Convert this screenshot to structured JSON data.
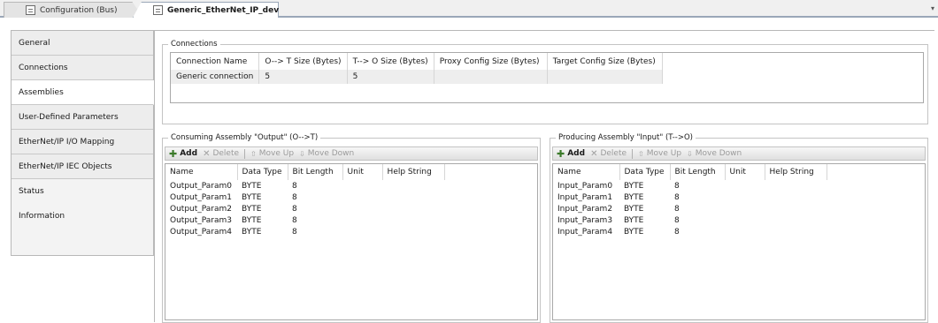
{
  "tabs": [
    {
      "label": "Configuration (Bus)",
      "icon": "config-icon"
    },
    {
      "label": "Generic_EtherNet_IP_device",
      "icon": "device-icon",
      "close": "x"
    }
  ],
  "nav": {
    "items": [
      {
        "label": "General"
      },
      {
        "label": "Connections"
      },
      {
        "label": "Assemblies"
      },
      {
        "label": "User-Defined Parameters"
      },
      {
        "label": "EtherNet/IP I/O Mapping"
      },
      {
        "label": "EtherNet/IP IEC Objects"
      },
      {
        "label": "Status"
      },
      {
        "label": "Information"
      }
    ],
    "selected": "Assemblies"
  },
  "connections": {
    "title": "Connections",
    "columns": [
      "Connection Name",
      "O--> T Size (Bytes)",
      "T--> O Size (Bytes)",
      "Proxy Config Size (Bytes)",
      "Target Config Size (Bytes)"
    ],
    "rows": [
      [
        "Generic connection",
        "5",
        "5",
        "",
        ""
      ]
    ]
  },
  "consuming": {
    "title": "Consuming Assembly \"Output\" (O-->T)",
    "toolbar": {
      "add": "Add",
      "delete": "Delete",
      "move_up": "Move Up",
      "move_down": "Move Down"
    },
    "columns": [
      "Name",
      "Data Type",
      "Bit Length",
      "Unit",
      "Help String"
    ],
    "rows": [
      [
        "Output_Param0",
        "BYTE",
        "8",
        "",
        ""
      ],
      [
        "Output_Param1",
        "BYTE",
        "8",
        "",
        ""
      ],
      [
        "Output_Param2",
        "BYTE",
        "8",
        "",
        ""
      ],
      [
        "Output_Param3",
        "BYTE",
        "8",
        "",
        ""
      ],
      [
        "Output_Param4",
        "BYTE",
        "8",
        "",
        ""
      ]
    ]
  },
  "producing": {
    "title": "Producing Assembly \"Input\" (T-->O)",
    "toolbar": {
      "add": "Add",
      "delete": "Delete",
      "move_up": "Move Up",
      "move_down": "Move Down"
    },
    "columns": [
      "Name",
      "Data Type",
      "Bit Length",
      "Unit",
      "Help String"
    ],
    "rows": [
      [
        "Input_Param0",
        "BYTE",
        "8",
        "",
        ""
      ],
      [
        "Input_Param1",
        "BYTE",
        "8",
        "",
        ""
      ],
      [
        "Input_Param2",
        "BYTE",
        "8",
        "",
        ""
      ],
      [
        "Input_Param3",
        "BYTE",
        "8",
        "",
        ""
      ],
      [
        "Input_Param4",
        "BYTE",
        "8",
        "",
        ""
      ]
    ]
  }
}
